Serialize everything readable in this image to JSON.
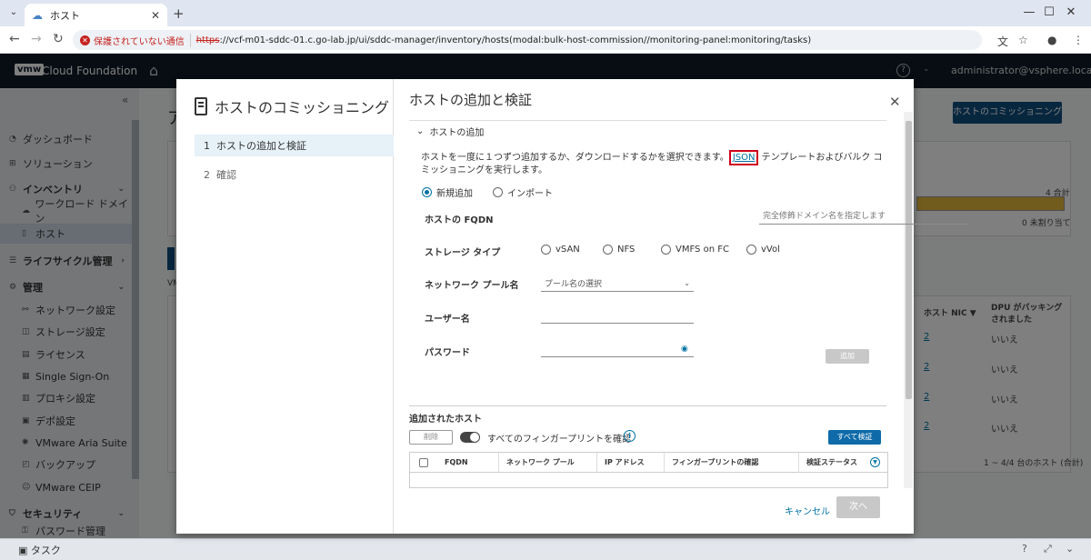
{
  "browser": {
    "tab_title": "ホスト",
    "security_warning": "保護されていない通信",
    "url_scheme": "https",
    "url_rest": "://vcf-m01-sddc-01.c.go-lab.jp/ui/sddc-manager/inventory/hosts(modal:bulk-host-commission//monitoring-panel:monitoring/tasks)"
  },
  "header": {
    "logo": "vmw",
    "product": "Cloud Foundation",
    "help": "?",
    "user": "administrator@vsphere.local"
  },
  "sidebar": {
    "items": [
      {
        "label": "ダッシュボード"
      },
      {
        "label": "ソリューション"
      },
      {
        "label": "インベントリ"
      },
      {
        "label": "ワークロード ドメイン"
      },
      {
        "label": "ホスト"
      },
      {
        "label": "ライフサイクル管理"
      },
      {
        "label": "管理"
      },
      {
        "label": "ネットワーク設定"
      },
      {
        "label": "ストレージ設定"
      },
      {
        "label": "ライセンス"
      },
      {
        "label": "Single Sign-On"
      },
      {
        "label": "プロキシ設定"
      },
      {
        "label": "デポ設定"
      },
      {
        "label": "VMware Aria Suite"
      },
      {
        "label": "バックアップ"
      },
      {
        "label": "VMware CEIP"
      },
      {
        "label": "セキュリティ"
      },
      {
        "label": "パスワード管理"
      }
    ]
  },
  "background": {
    "page_heading": "ア",
    "commission_button": "ホストのコミッショニング",
    "total": "4 合計",
    "unassigned": "0 未割り当て",
    "vm_label": "VM",
    "col_host_nic": "ホスト NIC",
    "col_dpu": "DPU がバッキングされました",
    "rows": [
      {
        "nic": "2",
        "dpu": "いいえ"
      },
      {
        "nic": "2",
        "dpu": "いいえ"
      },
      {
        "nic": "2",
        "dpu": "いいえ"
      },
      {
        "nic": "2",
        "dpu": "いいえ"
      }
    ],
    "pagination": "1 ~ 4/4 台のホスト (合計)"
  },
  "taskbar": {
    "label": "タスク"
  },
  "modal": {
    "wizard_title": "ホストのコミッショニング",
    "steps": [
      {
        "num": "1",
        "label": "ホストの追加と検証"
      },
      {
        "num": "2",
        "label": "確認"
      }
    ],
    "page_title": "ホストの追加と検証",
    "section_title": "ホストの追加",
    "description_before": "ホストを一度に１つずつ追加するか、ダウンロードするかを選択できます。",
    "json_link": "JSON",
    "description_after": " テンプレートおよびバルク コミッショニングを実行します。",
    "mode_options": [
      {
        "label": "新規追加",
        "selected": true
      },
      {
        "label": "インポート",
        "selected": false
      }
    ],
    "fqdn_label": "ホストの FQDN",
    "fqdn_placeholder": "完全修飾ドメイン名を指定します",
    "storage_label": "ストレージ タイプ",
    "storage_options": [
      "vSAN",
      "NFS",
      "VMFS on FC",
      "vVol"
    ],
    "pool_label": "ネットワーク プール名",
    "pool_placeholder": "プール名の選択",
    "username_label": "ユーザー名",
    "password_label": "パスワード",
    "add_button": "追加",
    "added_hosts_title": "追加されたホスト",
    "delete_button": "削除",
    "fingerprint_toggle_label": "すべてのフィンガープリントを確認",
    "verify_all_button": "すべて検証",
    "table_columns": [
      "FQDN",
      "ネットワーク プール",
      "IP アドレス",
      "フィンガープリントの確認",
      "検証ステータス"
    ],
    "cancel": "キャンセル",
    "next": "次へ"
  }
}
